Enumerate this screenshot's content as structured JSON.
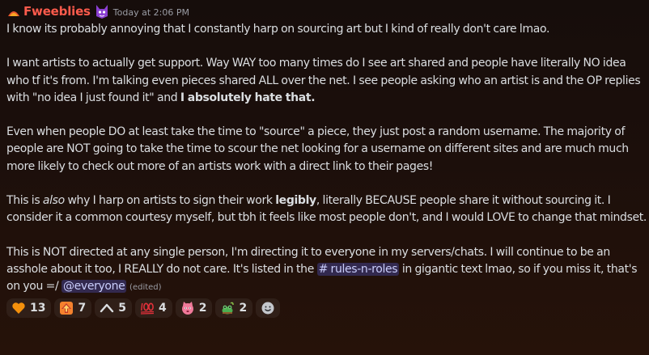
{
  "message": {
    "username": "Fweeblies",
    "timestamp": "Today at 2:06 PM",
    "paragraphs": {
      "p1": "I know its probably annoying that I constantly harp on sourcing art but I kind of really don't care lmao.",
      "p2_a": "I want artists to actually get support. Way WAY too many times do I see art shared and people have literally NO idea who tf it's from. I'm talking even pieces shared ALL over the net. I see people asking who an artist is and the OP replies with \"no idea I just found it\" and ",
      "p2_bold": "I absolutely hate that.",
      "p3": "Even when people DO at least take the time to \"source\" a piece, they just post a random username. The majority of people are NOT going to take the time to scour the net looking for a username on different sites and are much much more likely to check out more of an artists work with a direct link to their pages!",
      "p4_a": "This is ",
      "p4_italic": "also",
      "p4_b": " why I harp on artists to sign their work ",
      "p4_bold": "legibly",
      "p4_c": ", literally BECAUSE people share it without sourcing it. I consider it a common courtesy myself, but tbh it feels like most people don't, and I would LOVE to change that mindset.",
      "p5_a": "This is NOT directed at any single person, I'm directing it to everyone in my servers/chats. I will continue to be an asshole about it too, I REALLY do not care. It's listed in the ",
      "p5_channel": "# rules-n-roles",
      "p5_b": " in gigantic text lmao, so if you miss it, that's on you =/ ",
      "p5_mention": "@everyone",
      "edited": "(edited)"
    }
  },
  "reactions": [
    {
      "icon": "orange-heart-icon",
      "count": "13"
    },
    {
      "icon": "up-arrow-box-icon",
      "count": "7"
    },
    {
      "icon": "caret-up-icon",
      "count": "5"
    },
    {
      "icon": "hundred-points-icon",
      "count": "4"
    },
    {
      "icon": "cat-face-icon",
      "count": "2"
    },
    {
      "icon": "frog-plant-icon",
      "count": "2"
    }
  ],
  "add_reaction": {
    "icon": "add-reaction-icon"
  },
  "colors": {
    "username": "#ff5b4c",
    "mention_bg": "#3a3f7a",
    "mention_text": "#c9cdfb"
  }
}
